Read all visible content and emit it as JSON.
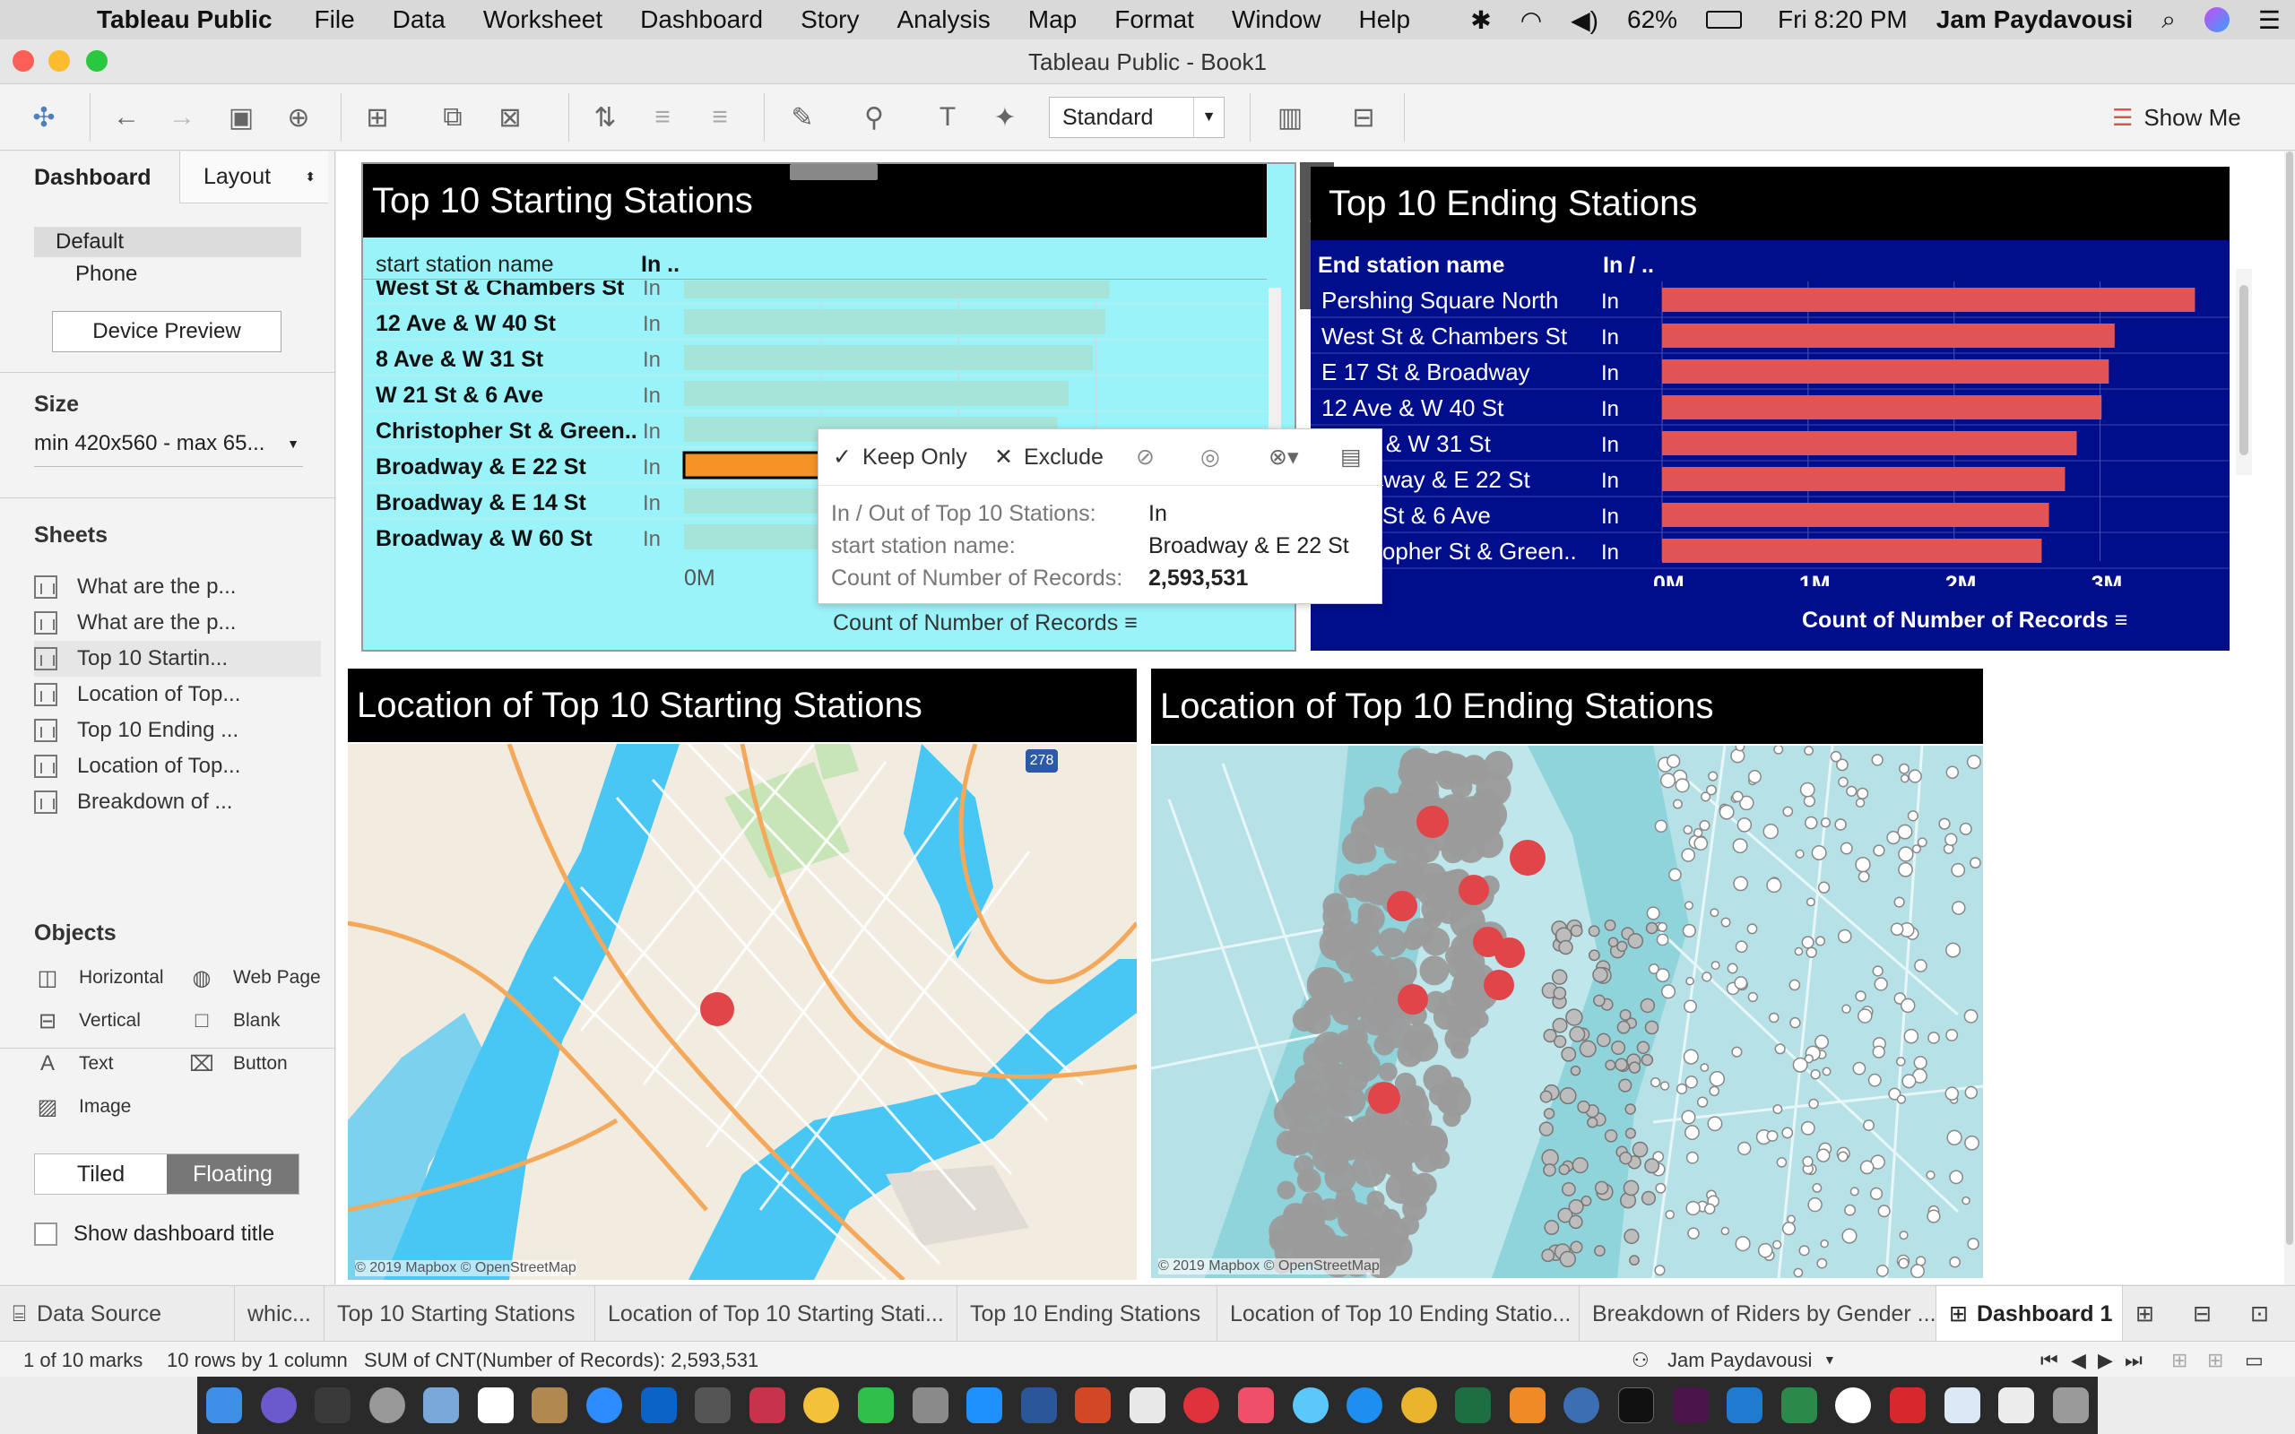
{
  "menubar": {
    "app_name": "Tableau Public",
    "items": [
      "File",
      "Data",
      "Worksheet",
      "Dashboard",
      "Story",
      "Analysis",
      "Map",
      "Format",
      "Window",
      "Help"
    ],
    "battery": "62%",
    "clock": "Fri 8:20 PM",
    "user": "Jam Paydavousi"
  },
  "window": {
    "title": "Tableau Public - Book1"
  },
  "toolbar": {
    "fit_value": "Standard",
    "show_me_label": "Show Me"
  },
  "left_pane": {
    "tabs": [
      "Dashboard",
      "Layout"
    ],
    "device_list": [
      "Default",
      "Phone"
    ],
    "device_preview_label": "Device Preview",
    "size_heading": "Size",
    "size_value": "min 420x560 - max 65...",
    "sheets_heading": "Sheets",
    "sheets": [
      "What are the p...",
      "What are the p...",
      "Top 10 Startin...",
      "Location of Top...",
      "Top 10 Ending ...",
      "Location of Top...",
      "Breakdown of ..."
    ],
    "objects_heading": "Objects",
    "objects": [
      "Horizontal",
      "Web Page",
      "Vertical",
      "Blank",
      "Text",
      "Button",
      "Image"
    ],
    "layout_modes": [
      "Tiled",
      "Floating"
    ],
    "show_title_label": "Show dashboard title"
  },
  "colors": {
    "start_bg": "#99f3f9",
    "start_bar": "#a6e4d9",
    "selected_bar": "#f59326",
    "end_bg": "#000e8c",
    "end_bar": "#e05456",
    "map_dot_red": "#e0454a",
    "map_dot_grey": "#9b9b9b"
  },
  "start_chart": {
    "title": "Top 10 Starting Stations",
    "col1_header": "start station name",
    "col2_header": "In ..",
    "rows": [
      {
        "name": "West St & Chambers St",
        "inout": "In",
        "value": 3100000
      },
      {
        "name": "12 Ave & W 40 St",
        "inout": "In",
        "value": 3070000
      },
      {
        "name": "8 Ave & W 31 St",
        "inout": "In",
        "value": 2980000
      },
      {
        "name": "W 21 St & 6 Ave",
        "inout": "In",
        "value": 2800000
      },
      {
        "name": "Christopher St & Green..",
        "inout": "In",
        "value": 2720000
      },
      {
        "name": "Broadway & E 22 St",
        "inout": "In",
        "value": 2593531,
        "selected": true
      },
      {
        "name": "Broadway & E 14 St",
        "inout": "In",
        "value": 2500000
      },
      {
        "name": "Broadway & W 60 St",
        "inout": "In",
        "value": 2450000
      }
    ],
    "axis_tick_first": "0M",
    "axis_label": "Count of Number of Records"
  },
  "end_chart": {
    "title": "Top 10 Ending Stations",
    "col1_header": "End station name",
    "col2_header": "In / ..",
    "rows": [
      {
        "name": "Pershing Square North",
        "inout": "In",
        "value": 3650000
      },
      {
        "name": "West St & Chambers St",
        "inout": "In",
        "value": 3100000
      },
      {
        "name": "E 17 St & Broadway",
        "inout": "In",
        "value": 3060000
      },
      {
        "name": "12 Ave & W 40 St",
        "inout": "In",
        "value": 3010000
      },
      {
        "name": "8 Ave & W 31 St",
        "inout": "In",
        "value": 2840000
      },
      {
        "name": "Broadway & E 22 St",
        "inout": "In",
        "value": 2760000
      },
      {
        "name": "W 21 St & 6 Ave",
        "inout": "In",
        "value": 2650000
      },
      {
        "name": "Christopher St & Green..",
        "inout": "In",
        "value": 2600000
      }
    ],
    "ticks": [
      "0M",
      "1M",
      "2M",
      "3M"
    ],
    "axis_label": "Count of Number of Records"
  },
  "tooltip": {
    "keep_only": "Keep Only",
    "exclude": "Exclude",
    "fields": [
      {
        "label": "In / Out of Top 10 Stations:",
        "value": "In"
      },
      {
        "label": "start station name:",
        "value": "Broadway & E 22 St"
      },
      {
        "label": "Count of Number of Records:",
        "value": "2,593,531"
      }
    ]
  },
  "map_start": {
    "title": "Location of Top 10 Starting Stations",
    "credit": "© 2019 Mapbox © OpenStreetMap",
    "shield": "278"
  },
  "map_end": {
    "title": "Location of Top 10 Ending Stations",
    "credit": "© 2019 Mapbox © OpenStreetMap"
  },
  "sheet_tabs": [
    "Data Source",
    "whic...",
    "Top 10 Starting Stations",
    "Location of Top 10 Starting Stati...",
    "Top 10 Ending Stations",
    "Location of Top 10 Ending Statio...",
    "Breakdown of Riders by Gender ...",
    "Dashboard 1"
  ],
  "status": {
    "marks": "1 of 10 marks",
    "rows": "10 rows by 1 column",
    "sum": "SUM of CNT(Number of Records): 2,593,531",
    "user": "Jam Paydavousi"
  }
}
